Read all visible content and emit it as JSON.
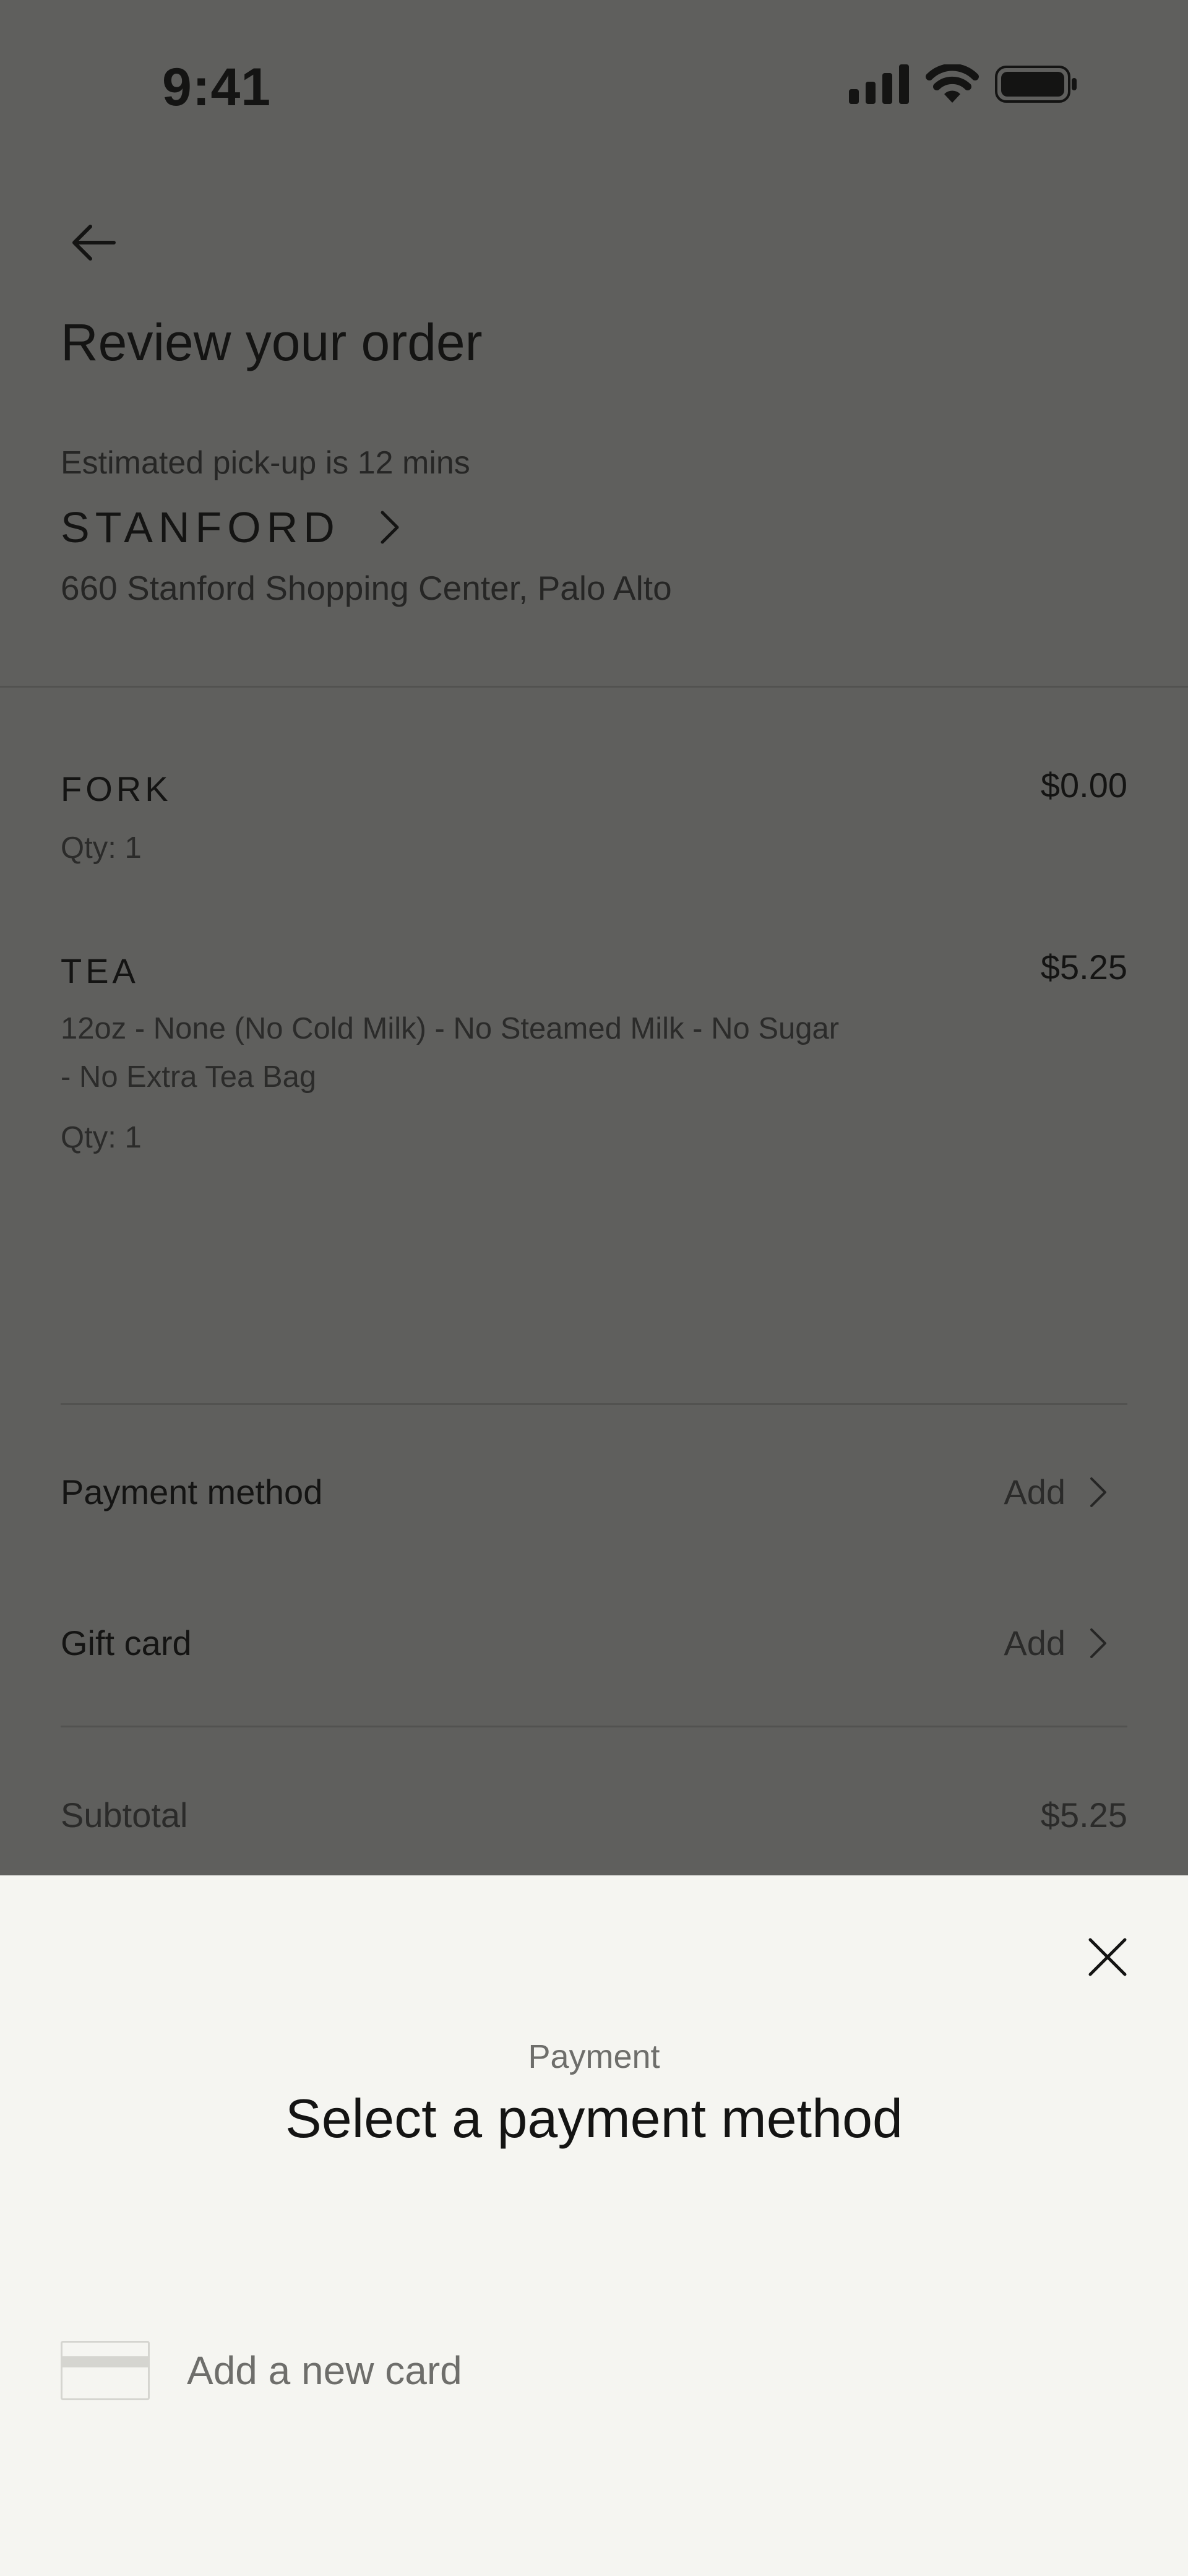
{
  "status_bar": {
    "time": "9:41",
    "icons": [
      "cellular-signal-icon",
      "wifi-icon",
      "battery-icon"
    ]
  },
  "header": {
    "back_icon": "arrow-left-icon",
    "title": "Review your order"
  },
  "store": {
    "eta": "Estimated pick-up is 12 mins",
    "name": "STANFORD",
    "address": "660 Stanford Shopping Center, Palo Alto"
  },
  "items": [
    {
      "name": "FORK",
      "price": "$0.00",
      "options": "",
      "qty": "Qty: 1"
    },
    {
      "name": "TEA",
      "price": "$5.25",
      "options_line1": "12oz - None (No Cold Milk) - No Steamed Milk - No Sugar",
      "options_line2": "- No Extra Tea Bag",
      "qty": "Qty: 1"
    }
  ],
  "payment": {
    "payment_method_label": "Payment method",
    "payment_method_action": "Add",
    "gift_card_label": "Gift card",
    "gift_card_action": "Add"
  },
  "summary": {
    "subtotal_label": "Subtotal",
    "subtotal_value": "$5.25"
  },
  "sheet": {
    "eyebrow": "Payment",
    "title": "Select a payment method",
    "add_card_label": "Add a new card",
    "close_icon": "close-icon",
    "card_icon": "credit-card-icon"
  },
  "colors": {
    "overlay_background": "#5f5f5d",
    "sheet_background": "#f5f5f1",
    "text_primary": "#141413",
    "text_muted": "#6e6e6b"
  }
}
